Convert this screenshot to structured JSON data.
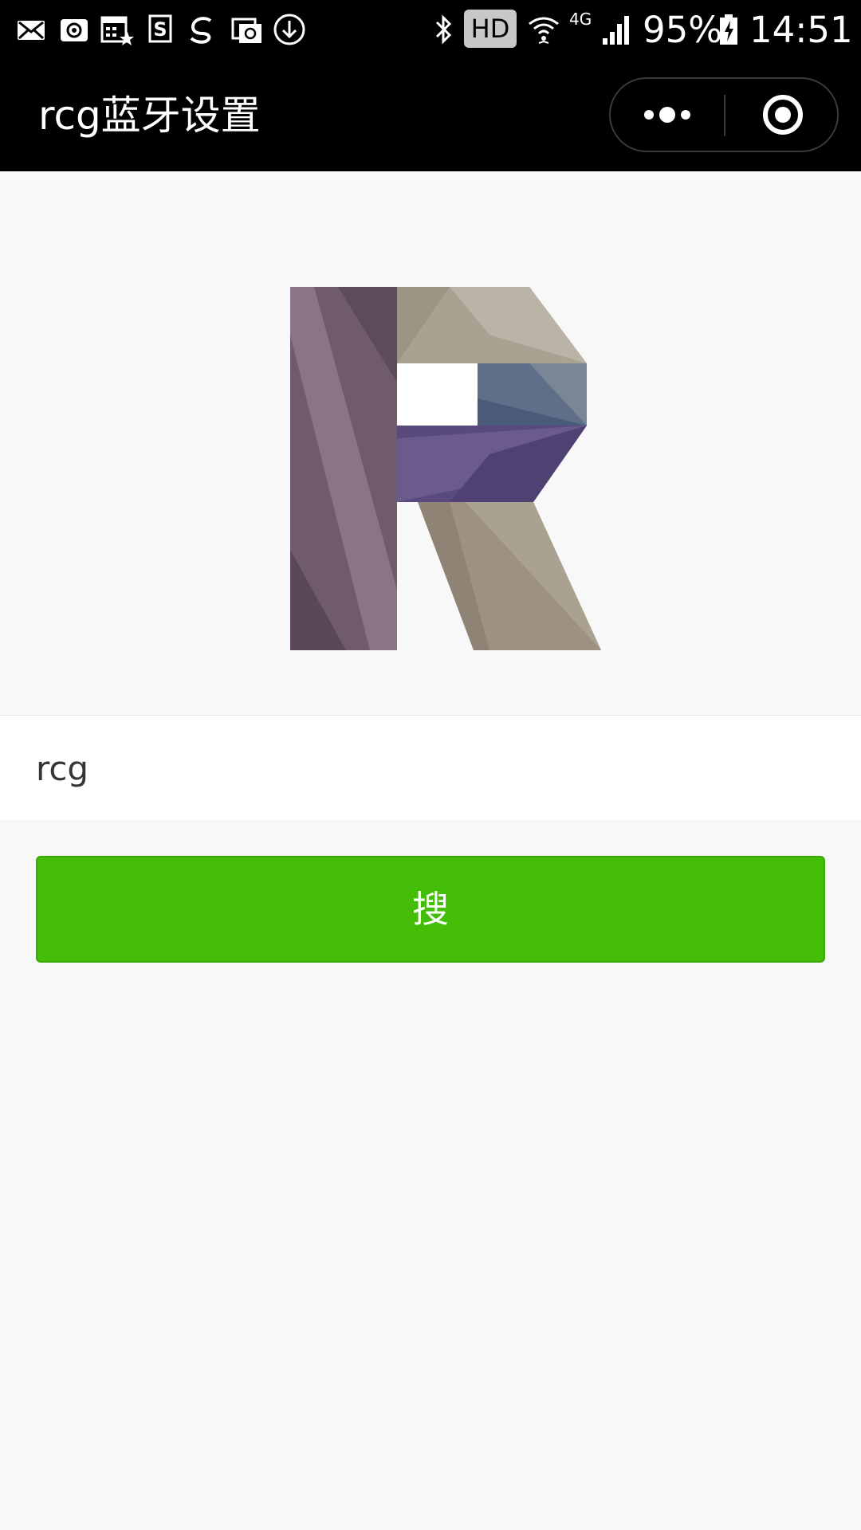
{
  "status_bar": {
    "battery": "95%",
    "time": "14:51",
    "network": "4G",
    "hd_badge": "HD",
    "icons": [
      "mail-icon",
      "at-mail-icon",
      "calendar-icon",
      "s-app-icon",
      "weibo-icon",
      "email-icon",
      "download-icon",
      "bluetooth-icon",
      "hd-icon",
      "wifi-icon",
      "signal-icon",
      "battery-icon"
    ]
  },
  "nav": {
    "title": "rcg蓝牙设置",
    "more_icon": "more-dots-icon",
    "close_icon": "target-close-icon"
  },
  "logo": {
    "name": "r-logo-icon"
  },
  "search": {
    "input_value": "rcg",
    "button_label": "搜"
  },
  "colors": {
    "nav_bg": "#000000",
    "page_bg": "#f8f8f8",
    "button_green": "#44bd08"
  }
}
